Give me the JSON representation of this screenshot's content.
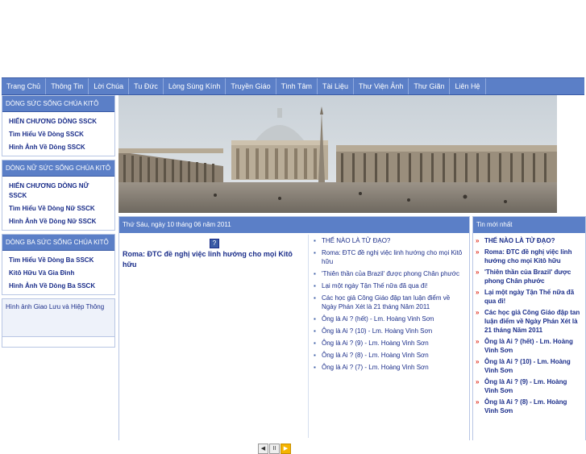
{
  "nav": {
    "items": [
      "Trang Chủ",
      "Thông Tin",
      "Lời Chúa",
      "Tu Đức",
      "Lòng Sùng Kính",
      "Truyền Giáo",
      "Tình Tâm",
      "Tài Liệu",
      "Thư Viện Ảnh",
      "Thư Giãn",
      "Liên Hệ"
    ]
  },
  "sidebar": {
    "boxes": [
      {
        "title": "DÒNG SỨC SỐNG CHÚA KITÔ",
        "links": [
          "HIẾN CHƯƠNG DÒNG SSCK",
          "Tìm Hiểu Về Dòng SSCK",
          "Hình Ảnh Về Dòng SSCK"
        ]
      },
      {
        "title": "DÒNG NỮ SỨC SỐNG CHÚA KITÔ",
        "links": [
          "HIẾN CHƯƠNG DÒNG NỮ SSCK",
          "Tìm Hiểu Về Dòng Nữ SSCK",
          "Hình Ảnh Về Dòng Nữ SSCK"
        ]
      },
      {
        "title": "DÒNG BA SỨC SỐNG CHÚA KITÔ",
        "links": [
          "Tìm Hiểu Về Dòng Ba SSCK",
          "Kitô Hữu Và Gia Đình",
          "Hình Ảnh Về Dòng Ba SSCK"
        ]
      },
      {
        "title": "Hình ảnh Giao Lưu và Hiệp Thông",
        "links": []
      }
    ]
  },
  "main": {
    "date": "Thứ Sáu, ngày 10 tháng 06 năm 2011",
    "feature_icon": "?",
    "feature_title": "Roma: ĐTC đề nghị việc linh hướng cho mọi Kitô hữu",
    "list": [
      "THẾ NÀO LÀ TỬ ĐẠO?",
      "Roma: ĐTC đề nghị việc linh hướng cho mọi Kitô hữu",
      "'Thiên thần của Brazil' được phong Chân phước",
      "Lại một ngày Tận Thế nữa đã qua đi!",
      "Các học giả Công Giáo đập tan luận điểm về Ngày Phán Xét là 21 tháng Năm 2011",
      "Ông là Ai ? (hết) - Lm. Hoàng Vinh Sơn",
      "Ông là Ai ? (10) - Lm. Hoàng Vinh Sơn",
      "Ông là Ai ? (9) - Lm. Hoàng Vinh Sơn",
      "Ông là Ai ? (8) - Lm. Hoàng Vinh Sơn",
      "Ông là Ai ? (7) - Lm. Hoàng Vinh Sơn"
    ],
    "controls": [
      "◀",
      "II",
      "▶"
    ]
  },
  "right": {
    "title": "Tin mới nhất",
    "arrow": "»",
    "items": [
      "THẾ NÀO LÀ TỬ ĐẠO?",
      "Roma: ĐTC đề nghị việc linh hướng cho mọi Kitô hữu",
      "'Thiên thần của Brazil' được phong Chân phước",
      "Lại một ngày Tận Thế nữa đã qua đi!",
      "Các học giả Công Giáo đập tan luận điểm về Ngày Phán Xét là 21 tháng Năm 2011",
      "Ông là Ai ? (hết) - Lm. Hoàng Vinh Sơn",
      "Ông là Ai ? (10) - Lm. Hoàng Vinh Sơn",
      "Ông là Ai ? (9) - Lm. Hoàng Vinh Sơn",
      "Ông là Ai ? (8) - Lm. Hoàng Vinh Sơn"
    ]
  },
  "colors": {
    "nav_bg": "#5b7fc7",
    "link": "#1b2e8a",
    "arrow": "#e03020"
  }
}
